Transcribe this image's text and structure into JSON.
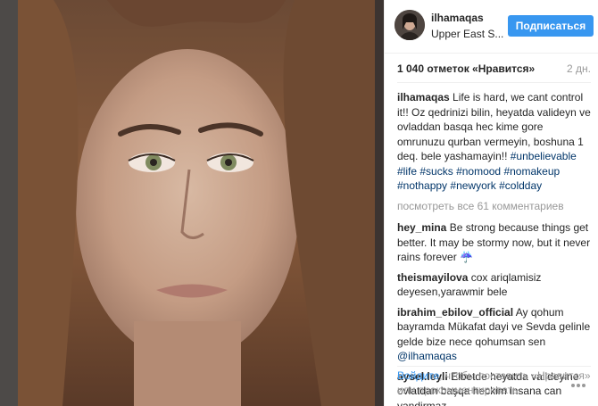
{
  "post": {
    "photo_alt": "",
    "header": {
      "username": "ilhamaqas",
      "location": "Upper East S...",
      "follow_label": "Подписаться"
    },
    "likes_text": "1 040 отметок «Нравится»",
    "time_ago": "2 дн.",
    "caption": {
      "user": "ilhamaqas",
      "text": "Life is hard, we cant control it!! Oz qedrinizi bilin, heyatda valideyn ve ovladdan basqa hec kime gore omrunuzu qurban vermeyin, boshuna 1 deq. bele yashamayin!! ",
      "hashtags": [
        "#unbelievable",
        "#life",
        "#sucks",
        "#nomood",
        "#nomakeup",
        "#nothappy",
        "#newyork",
        "#coldday"
      ]
    },
    "view_all_comments": "посмотреть все 61 комментариев",
    "comments": [
      {
        "user": "hey_mina",
        "text": "Be strong because things get better. It may be stormy now, but it never rains forever ☔"
      },
      {
        "user": "theismayilova",
        "text": "cox ariqlamisiz deyesen,yarawmir bele"
      },
      {
        "user": "ibrahim_ebilov_official",
        "text": "Ay qohum bayramda Mükafat dayi ve Sevda gelinle gelde bize nece qohumsan sen ",
        "mention": "@ilhamaqas"
      },
      {
        "user": "aysel.leyli",
        "text": "Elbetde heyatda valideyine ovlatdan başqa heckim insana can yandirmaz"
      }
    ],
    "footer": {
      "login_label": "Войдите",
      "login_suffix": ", чтобы поставить «Нравится» или прокомментировать."
    },
    "more_icon": "more-dots-icon",
    "colors": {
      "accent": "#3897f0",
      "link": "#003569",
      "muted": "#999999",
      "text": "#262626"
    }
  }
}
